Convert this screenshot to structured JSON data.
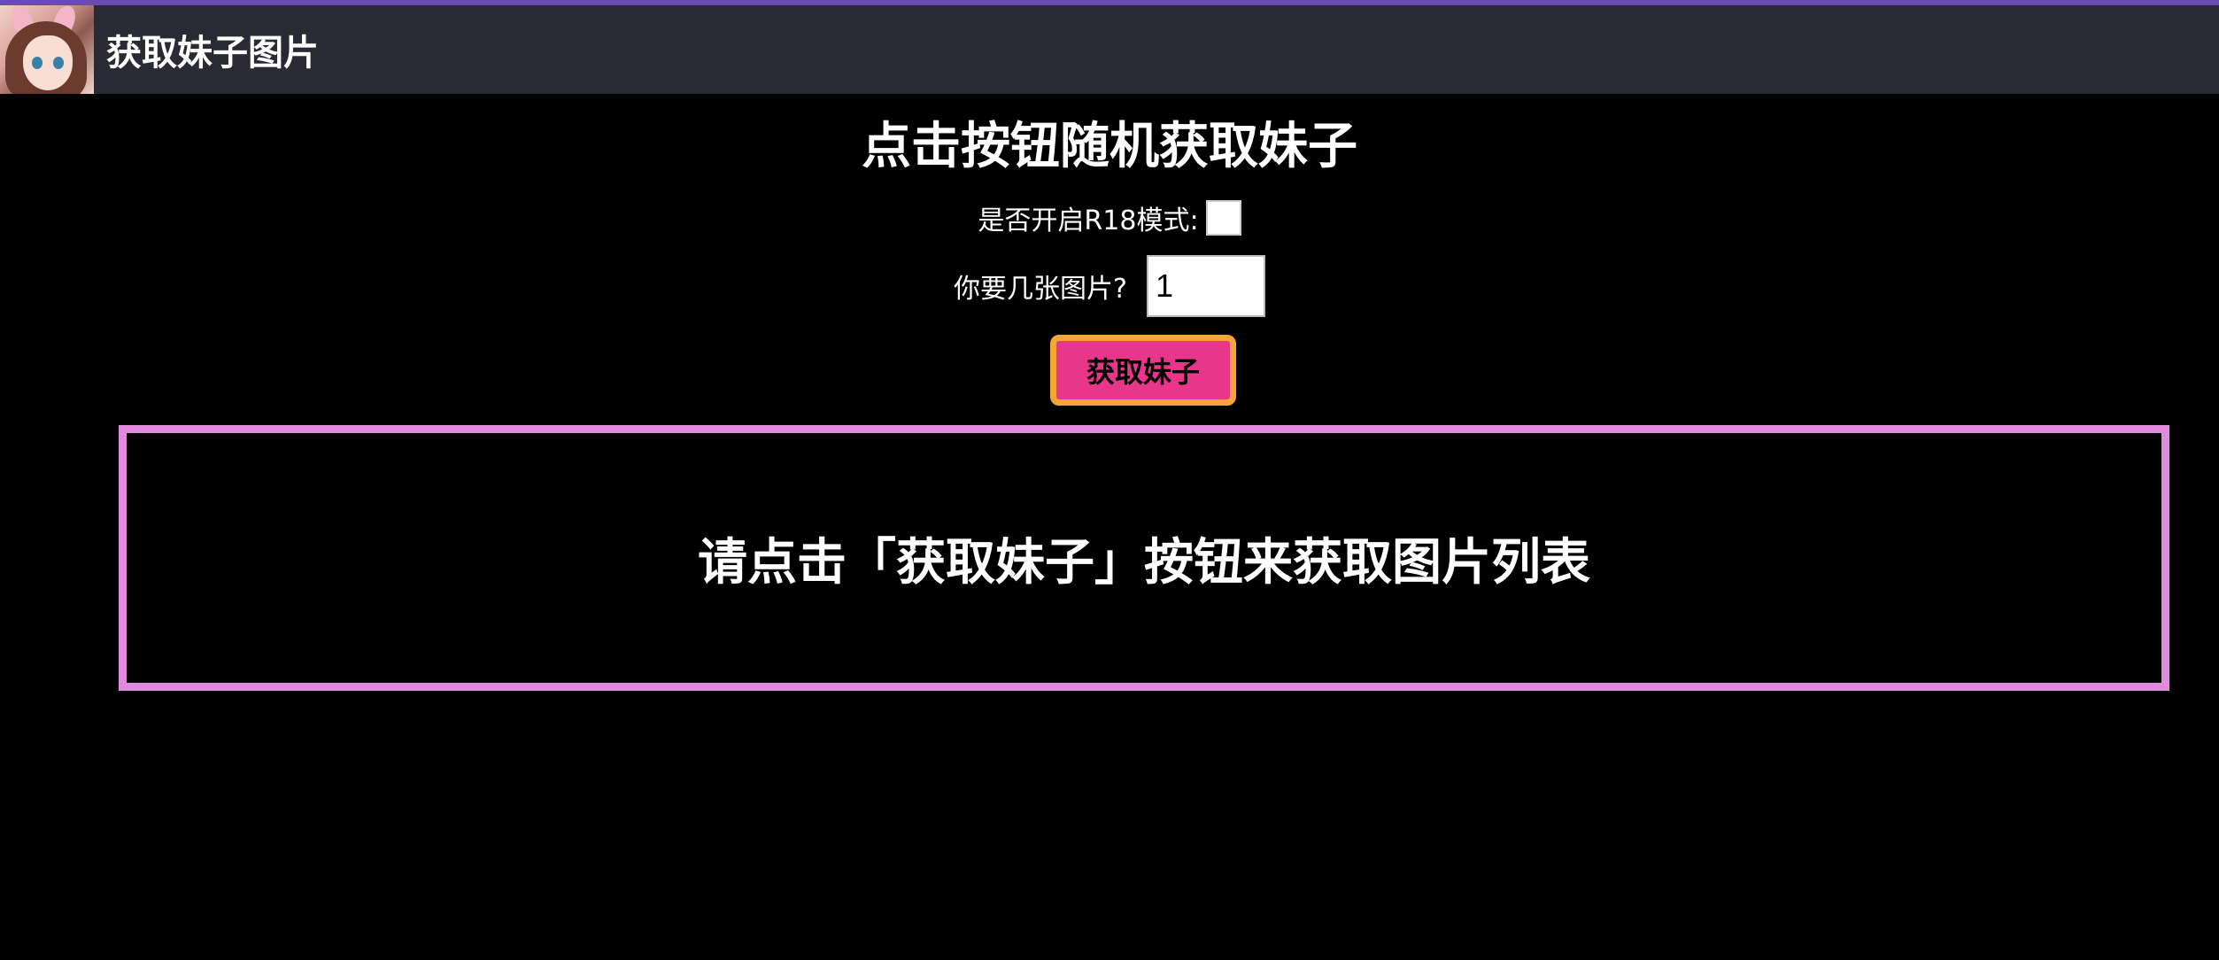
{
  "header": {
    "title": "获取妹子图片"
  },
  "main": {
    "page_title": "点击按钮随机获取妹子",
    "rib_label": "是否开启R18模式:",
    "count_label": "你要几张图片?",
    "count_value": "1",
    "get_button_label": "获取妹子",
    "result_placeholder": "请点击「获取妹子」按钮来获取图片列表"
  },
  "colors": {
    "background": "#000000",
    "header_bg": "#2a2a35",
    "accent_top": "#6b4bb0",
    "button_bg": "#e8368a",
    "button_border": "#f5a53a",
    "result_border": "#e08ae0"
  }
}
